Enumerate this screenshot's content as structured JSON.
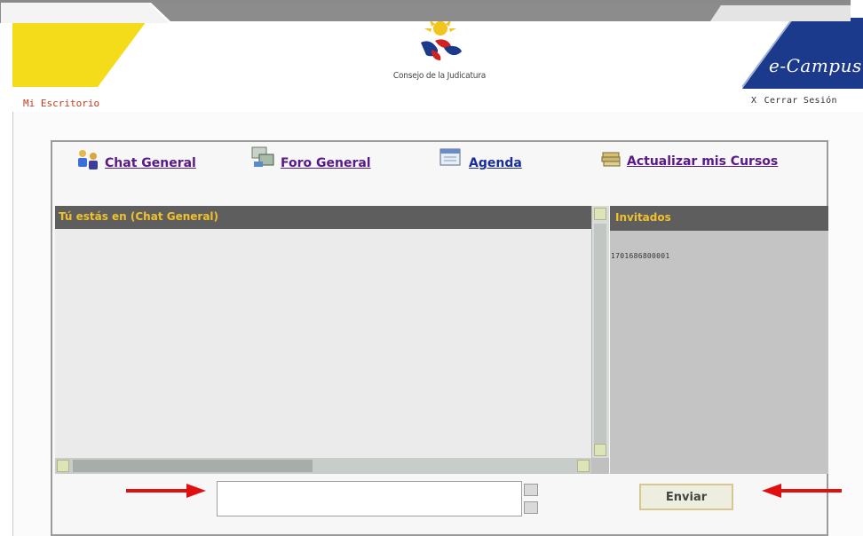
{
  "header": {
    "organization": "Consejo de la Judicatura",
    "brand": "e-Campus"
  },
  "tabs": {
    "active": "Mi Escritorio",
    "logout": "Cerrar Sesión",
    "logout_mark": "X"
  },
  "nav": [
    {
      "label": "Chat General",
      "icon": "chat-users-icon"
    },
    {
      "label": "Foro General",
      "icon": "forum-icon"
    },
    {
      "label": "Agenda",
      "icon": "agenda-icon"
    },
    {
      "label": "Actualizar mis Cursos",
      "icon": "books-icon"
    }
  ],
  "chat": {
    "location_title": "Tú estás en (Chat General)",
    "guests_title": "Invitados",
    "guests": [
      "1701686800001"
    ],
    "message_value": "",
    "send_label": "Enviar"
  },
  "colors": {
    "brand_yellow": "#f5dc1a",
    "brand_blue": "#1c3a8c",
    "header_dark": "#5e5e5e",
    "header_text": "#f1c12a",
    "link_purple": "#5a1a86",
    "arrow_red": "#e01010"
  }
}
